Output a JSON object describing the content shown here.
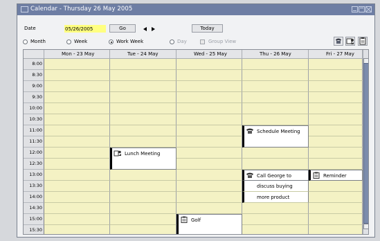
{
  "window": {
    "title": "Calendar - Thursday 26 May 2005"
  },
  "toolbar": {
    "date_label": "Date",
    "date_value": "05/26/2005",
    "go_label": "Go",
    "today_label": "Today",
    "view_options": [
      {
        "label": "Month",
        "selected": false
      },
      {
        "label": "Week",
        "selected": false
      },
      {
        "label": "Work Week",
        "selected": true
      },
      {
        "label": "Day",
        "selected": false
      }
    ],
    "group_view_label": "Group View"
  },
  "calendar": {
    "days": [
      "Mon - 23 May",
      "Tue - 24 May",
      "Wed - 25 May",
      "Thu - 26 May",
      "Fri - 27 May"
    ],
    "times": [
      "8:00",
      "8:30",
      "9:00",
      "9:30",
      "10:00",
      "10:30",
      "11:00",
      "11:30",
      "12:00",
      "12:30",
      "13:00",
      "13:30",
      "14:00",
      "14:30",
      "15:00",
      "15:30"
    ],
    "appointments": {
      "schedule_meeting": "Schedule Meeting",
      "lunch_meeting": "Lunch Meeting",
      "call_george_1": "Call George to",
      "call_george_2": "discuss buying",
      "call_george_3": "more product",
      "reminder": "Reminder",
      "golf": "Golf"
    }
  },
  "icons": {
    "phone": "phone-icon",
    "meeting": "meeting-icon",
    "note": "note-icon"
  }
}
